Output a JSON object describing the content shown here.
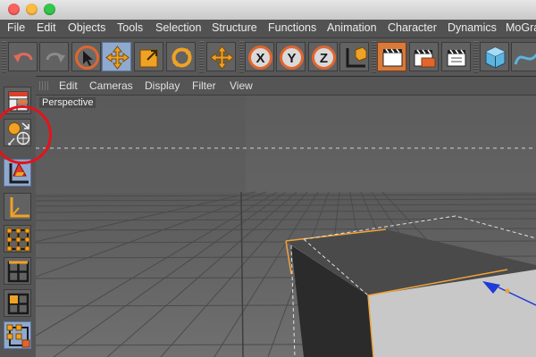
{
  "window": {
    "buttons": [
      "close",
      "minimize",
      "zoom"
    ],
    "colors": {
      "close": "#fc615d",
      "minimize": "#fdbc40",
      "zoom": "#34c84a"
    }
  },
  "menubar": {
    "items": [
      "File",
      "Edit",
      "Objects",
      "Tools",
      "Selection",
      "Structure",
      "Functions",
      "Animation",
      "Character",
      "Dynamics",
      "MoGra"
    ]
  },
  "toolbar": {
    "tools": [
      {
        "name": "undo-icon"
      },
      {
        "name": "redo-icon"
      },
      {
        "name": "live-selection-icon"
      },
      {
        "name": "move-icon",
        "selected": true
      },
      {
        "name": "scale-icon"
      },
      {
        "name": "rotate-icon"
      },
      {
        "name": "move-icon-2"
      },
      {
        "name": "x-axis-icon",
        "label": "X"
      },
      {
        "name": "y-axis-icon",
        "label": "Y"
      },
      {
        "name": "z-axis-icon",
        "label": "Z"
      },
      {
        "name": "coordinate-system-icon"
      },
      {
        "name": "render-view-icon"
      },
      {
        "name": "render-picture-viewer-icon"
      },
      {
        "name": "render-settings-icon"
      },
      {
        "name": "cube-icon"
      },
      {
        "name": "spline-icon"
      }
    ]
  },
  "left_tools": [
    {
      "name": "layout-icon"
    },
    {
      "name": "model-object-mode-icon"
    },
    {
      "name": "object-axis-icon"
    },
    {
      "name": "texture-axis-icon"
    },
    {
      "name": "points-mode-icon"
    },
    {
      "name": "edges-mode-icon"
    },
    {
      "name": "polygons-mode-icon"
    },
    {
      "name": "uvw-mode-icon"
    }
  ],
  "viewport": {
    "menu": [
      "Edit",
      "Cameras",
      "Display",
      "Filter",
      "View"
    ],
    "label": "Perspective"
  },
  "colors": {
    "accent": "#8fa9cf",
    "selection_edge": "#f2a23a",
    "annotation": "#e4131b",
    "cube_light_face": "#c8c8c8",
    "cube_dark_face": "#2b2b2b",
    "axis_blue": "#1e3ad8"
  }
}
